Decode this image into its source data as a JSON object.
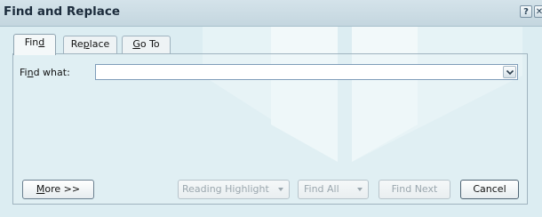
{
  "window": {
    "title": "Find and Replace",
    "help_glyph": "?",
    "close_glyph": "✕"
  },
  "tabs": [
    {
      "pre": "Fin",
      "key": "d",
      "post": ""
    },
    {
      "pre": "Re",
      "key": "p",
      "post": "lace"
    },
    {
      "pre": "",
      "key": "G",
      "post": "o To"
    }
  ],
  "find": {
    "label_pre": "Fi",
    "label_key": "n",
    "label_post": "d what:",
    "value": ""
  },
  "buttons": {
    "more_key": "M",
    "more_rest": "ore >>",
    "reading_highlight": "Reading Highlight",
    "find_all": "Find All",
    "find_next": "Find Next",
    "cancel": "Cancel"
  },
  "colors": {
    "background": "#dcedf2",
    "disabled_text": "#9ba7ae"
  }
}
